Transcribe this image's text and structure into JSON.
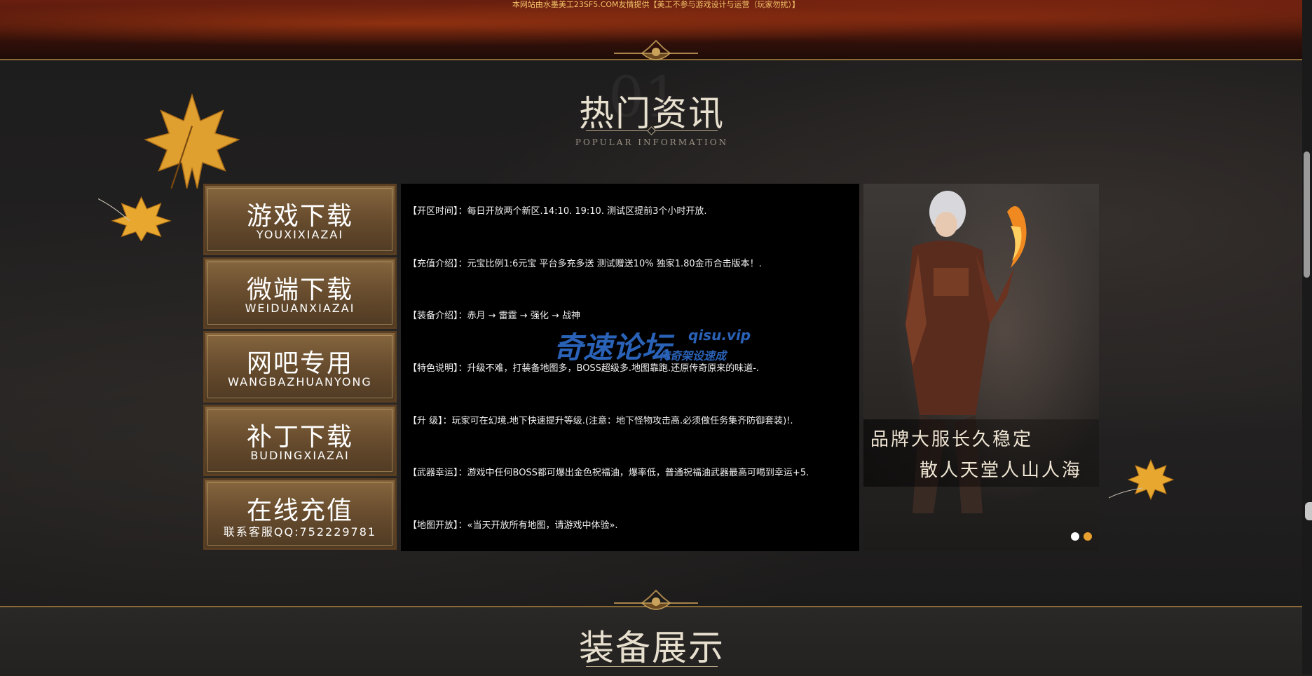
{
  "banner": {
    "notice": "本网站由水墨美工23SF5.COM友情提供【美工不参与游戏设计与运营（玩家勿扰）】"
  },
  "hot_news": {
    "bg_number": "01",
    "title": "热门资讯",
    "subtitle": "POPULAR INFORMATION"
  },
  "nav_buttons": [
    {
      "title": "游戏下载",
      "subtitle": "YOUXIXIAZAI"
    },
    {
      "title": "微端下载",
      "subtitle": "WEIDUANXIAZAI"
    },
    {
      "title": "网吧专用",
      "subtitle": "WANGBAZHUANYONG"
    },
    {
      "title": "补丁下载",
      "subtitle": "BUDINGXIAZAI"
    },
    {
      "title": "在线充值",
      "subtitle": "联系客服QQ:752229781"
    }
  ],
  "info_rows": [
    "【开区时间】：每日开放两个新区.14:10. 19:10. 测试区提前3个小时开放.",
    "【充值介绍】：元宝比例1:6元宝 平台多充多送   测试赠送10%   独家1.80金币合击版本！.",
    "【装备介绍】：赤月 → 雷霆 → 强化 → 战神",
    "【特色说明】：升级不难，打装备地图多，BOSS超级多.地图靠跑.还原传奇原来的味道-.",
    "【升      级】：玩家可在幻境.地下快速提升等级.(注意：地下怪物攻击高.必须做任务集齐防御套装)!.",
    "【武器幸运】：游戏中任何BOSS都可爆出金色祝福油，爆率低，普通祝福油武器最高可喝到幸运+5.",
    "【地图开放】：«当天开放所有地图，请游戏中体验»."
  ],
  "watermark": {
    "main": "奇速论坛",
    "url": "qisu.vip",
    "sub": "传奇架设速成"
  },
  "promo": {
    "line1": "品牌大服长久稳定",
    "line2": "散人天堂人山人海"
  },
  "equipment": {
    "title": "装备展示"
  },
  "colors": {
    "gold_accent": "#e8a030",
    "button_bg": "#6a4e2f",
    "watermark_blue": "#2a62b8"
  }
}
